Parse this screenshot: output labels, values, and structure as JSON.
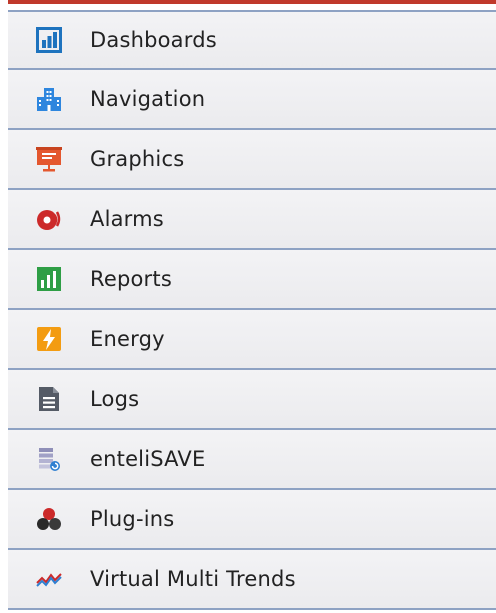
{
  "menu": {
    "items": [
      {
        "label": "Dashboards",
        "icon": "dashboard-icon"
      },
      {
        "label": "Navigation",
        "icon": "buildings-icon"
      },
      {
        "label": "Graphics",
        "icon": "presentation-icon"
      },
      {
        "label": "Alarms",
        "icon": "alarm-bell-icon"
      },
      {
        "label": "Reports",
        "icon": "report-chart-icon"
      },
      {
        "label": "Energy",
        "icon": "lightning-icon"
      },
      {
        "label": "Logs",
        "icon": "document-icon"
      },
      {
        "label": "enteliSAVE",
        "icon": "entelisave-icon"
      },
      {
        "label": "Plug-ins",
        "icon": "plugins-icon"
      },
      {
        "label": "Virtual Multi Trends",
        "icon": "multi-trends-icon"
      }
    ]
  },
  "colors": {
    "divider": "#8ea2c3",
    "accent_top": "#c0392b",
    "dashboard_blue": "#1e73be",
    "navigation_blue": "#2e86de",
    "graphics_orange": "#e4572e",
    "alarm_red": "#cc2a2a",
    "report_green": "#2e9e45",
    "energy_orange": "#f39c12",
    "logs_gray": "#555b66"
  }
}
